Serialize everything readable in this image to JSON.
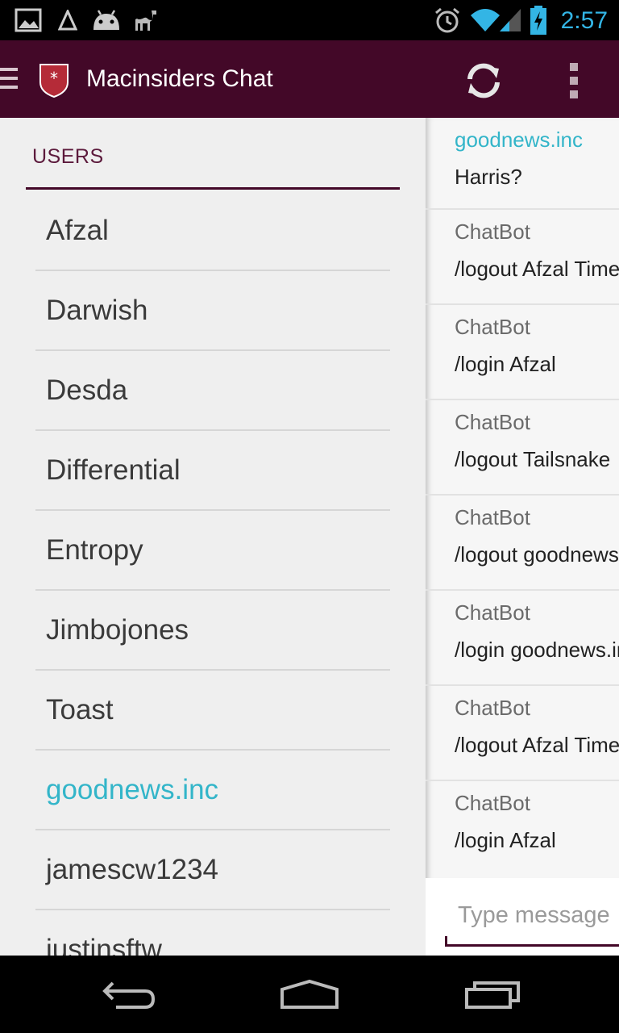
{
  "status_bar": {
    "time": "2:57",
    "icons": [
      "gallery-icon",
      "delta-icon",
      "android-icon",
      "camel-icon",
      "alarm-icon",
      "wifi-icon",
      "signal-icon",
      "battery-charging-icon"
    ],
    "accent_color": "#33b5e5"
  },
  "action_bar": {
    "title": "Macinsiders Chat",
    "background": "#430828",
    "icons": [
      "menu-icon",
      "app-logo-icon",
      "refresh-icon",
      "overflow-menu-icon"
    ]
  },
  "drawer": {
    "header": "USERS",
    "users": [
      {
        "name": "Afzal"
      },
      {
        "name": "Darwish"
      },
      {
        "name": "Desda"
      },
      {
        "name": "Differential"
      },
      {
        "name": "Entropy"
      },
      {
        "name": "Jimbojones"
      },
      {
        "name": "Toast"
      },
      {
        "name": "goodnews.inc",
        "highlight": true
      },
      {
        "name": "jamescw1234"
      },
      {
        "name": "justinsftw"
      }
    ],
    "highlight_color": "#33b5c9"
  },
  "chat": {
    "messages": [
      {
        "author": "goodnews.inc",
        "text": "Harris?"
      },
      {
        "author": "ChatBot",
        "text": "/logout Afzal Timeout"
      },
      {
        "author": "ChatBot",
        "text": "/login Afzal"
      },
      {
        "author": "ChatBot",
        "text": "/logout Tailsnake"
      },
      {
        "author": "ChatBot",
        "text": "/logout goodnews.inc"
      },
      {
        "author": "ChatBot",
        "text": "/login goodnews.inc"
      },
      {
        "author": "ChatBot",
        "text": "/logout Afzal Timeout"
      },
      {
        "author": "ChatBot",
        "text": "/login Afzal"
      }
    ],
    "composer_placeholder": "Type message"
  },
  "nav_bar": {
    "icons": [
      "back-icon",
      "home-icon",
      "recent-apps-icon"
    ]
  }
}
